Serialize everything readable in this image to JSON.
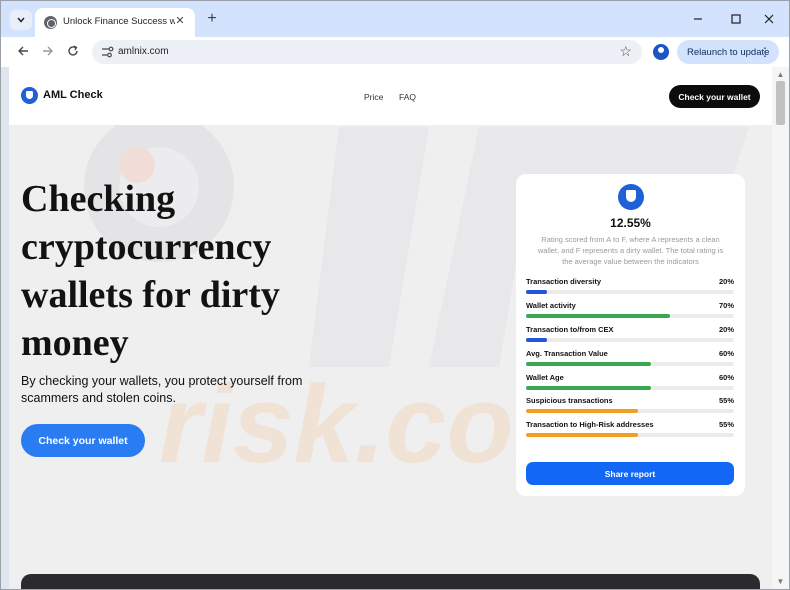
{
  "browser": {
    "tab_title": "Unlock Finance Success with AML",
    "url": "amlnix.com",
    "relaunch_label": "Relaunch to update",
    "new_tab_glyph": "+",
    "close_glyph": "✕"
  },
  "site": {
    "logo": "AML Check",
    "nav": [
      "Price",
      "FAQ"
    ],
    "header_cta": "Check your wallet",
    "hero": {
      "title": "Checking cryptocurrency wallets for dirty money",
      "subtitle": "By checking your wallets, you protect yourself from scammers and stolen coins.",
      "cta": "Check your wallet"
    },
    "card": {
      "percent": "12.55%",
      "description": "Rating scored from A to F, where A represents a clean wallet, and F represents a dirty wallet. The total rating is the average value between the indicators",
      "metrics": [
        {
          "label": "Transaction diversity",
          "value": "20%",
          "fraction": 0.1,
          "color": "#1f55e0"
        },
        {
          "label": "Wallet activity",
          "value": "70%",
          "fraction": 0.69,
          "color": "#3aa84e"
        },
        {
          "label": "Transaction to/from CEX",
          "value": "20%",
          "fraction": 0.1,
          "color": "#1f55e0"
        },
        {
          "label": "Avg. Transaction Value",
          "value": "60%",
          "fraction": 0.6,
          "color": "#3aa84e"
        },
        {
          "label": "Wallet Age",
          "value": "60%",
          "fraction": 0.6,
          "color": "#3aa84e"
        },
        {
          "label": "Suspicious transactions",
          "value": "55%",
          "fraction": 0.54,
          "color": "#f2a11f"
        },
        {
          "label": "Transaction to High-Risk addresses",
          "value": "55%",
          "fraction": 0.54,
          "color": "#f2a11f"
        }
      ],
      "share": "Share report"
    }
  },
  "colors": {
    "accent_blue": "#2a7cf2",
    "button_blue": "#1268f4",
    "dark": "#0c0c0c"
  }
}
